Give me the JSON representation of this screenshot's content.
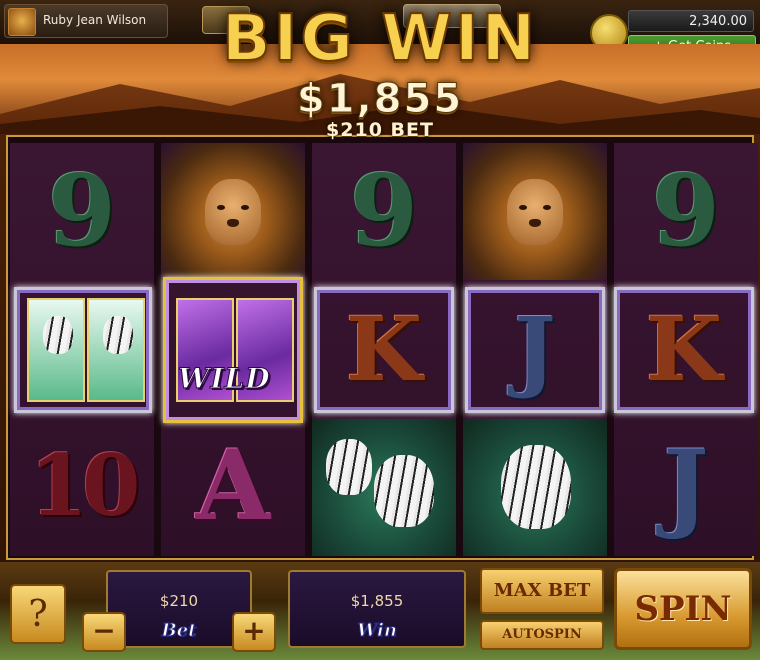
{
  "player": {
    "name": "Ruby Jean Wilson"
  },
  "header": {
    "balance": "2,340.00",
    "get_coins_label": "+ Get Coins"
  },
  "win_banner": {
    "headline": "BIG WIN",
    "win_amount": "$1,855",
    "bet_text": "$210 BET"
  },
  "reels": [
    [
      "9",
      "tiger-pair-stacked",
      "10"
    ],
    [
      "lion",
      "wild",
      "A"
    ],
    [
      "9",
      "K",
      "tiger-pair"
    ],
    [
      "lion",
      "J",
      "tiger"
    ],
    [
      "9",
      "K",
      "J"
    ]
  ],
  "wild_label": "WILD",
  "controls": {
    "help_label": "?",
    "bet_value": "$210",
    "bet_label": "Bet",
    "minus_label": "−",
    "plus_label": "+",
    "win_value": "$1,855",
    "win_label": "Win",
    "max_bet_label": "MAX BET",
    "autospin_label": "AUTOSPIN",
    "spin_label": "SPIN"
  },
  "colors": {
    "gold": "#f8d050",
    "reel_bg": "#3a1632",
    "get_coins": "#4c9a30"
  }
}
